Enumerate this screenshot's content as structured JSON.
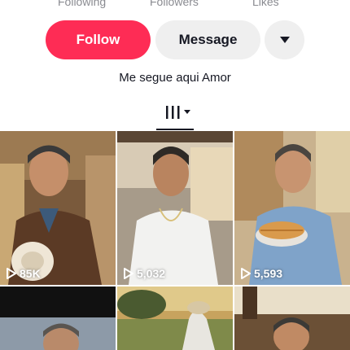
{
  "profile": {
    "stats_labels": [
      "Following",
      "Followers",
      "Likes"
    ],
    "follow_label": "Follow",
    "message_label": "Message",
    "bio": "Me segue aqui Amor"
  },
  "videos": [
    {
      "views": "85K"
    },
    {
      "views": "5,032"
    },
    {
      "views": "5,593"
    },
    {
      "views": ""
    },
    {
      "views": ""
    },
    {
      "views": ""
    }
  ],
  "colors": {
    "accent": "#fe2c55",
    "secondary_button": "#efefef",
    "text": "#161823",
    "muted": "#8a8b91"
  },
  "icons": {
    "more": "chevron-down-icon",
    "tab": "grid-filter-icon",
    "play": "play-icon"
  }
}
